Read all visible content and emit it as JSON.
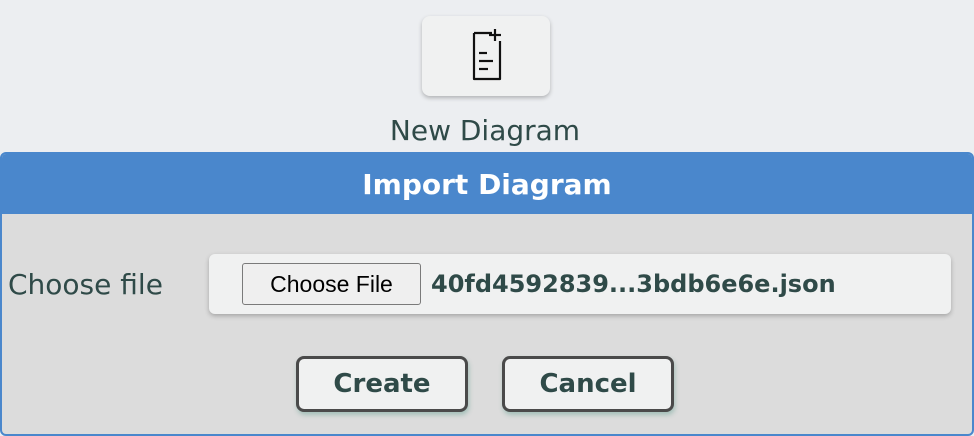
{
  "new_diagram": {
    "icon": "new-document-icon",
    "label": "New Diagram"
  },
  "import_dialog": {
    "title": "Import Diagram",
    "file_field_label": "Choose file",
    "choose_file_button": "Choose File",
    "selected_file_name": "40fd4592839...3bdb6e6e.json",
    "create_button": "Create",
    "cancel_button": "Cancel"
  },
  "colors": {
    "accent": "#4a87cc",
    "text": "#2f4a48",
    "background": "#eceef1",
    "dialog_body": "#dcdcdc"
  }
}
